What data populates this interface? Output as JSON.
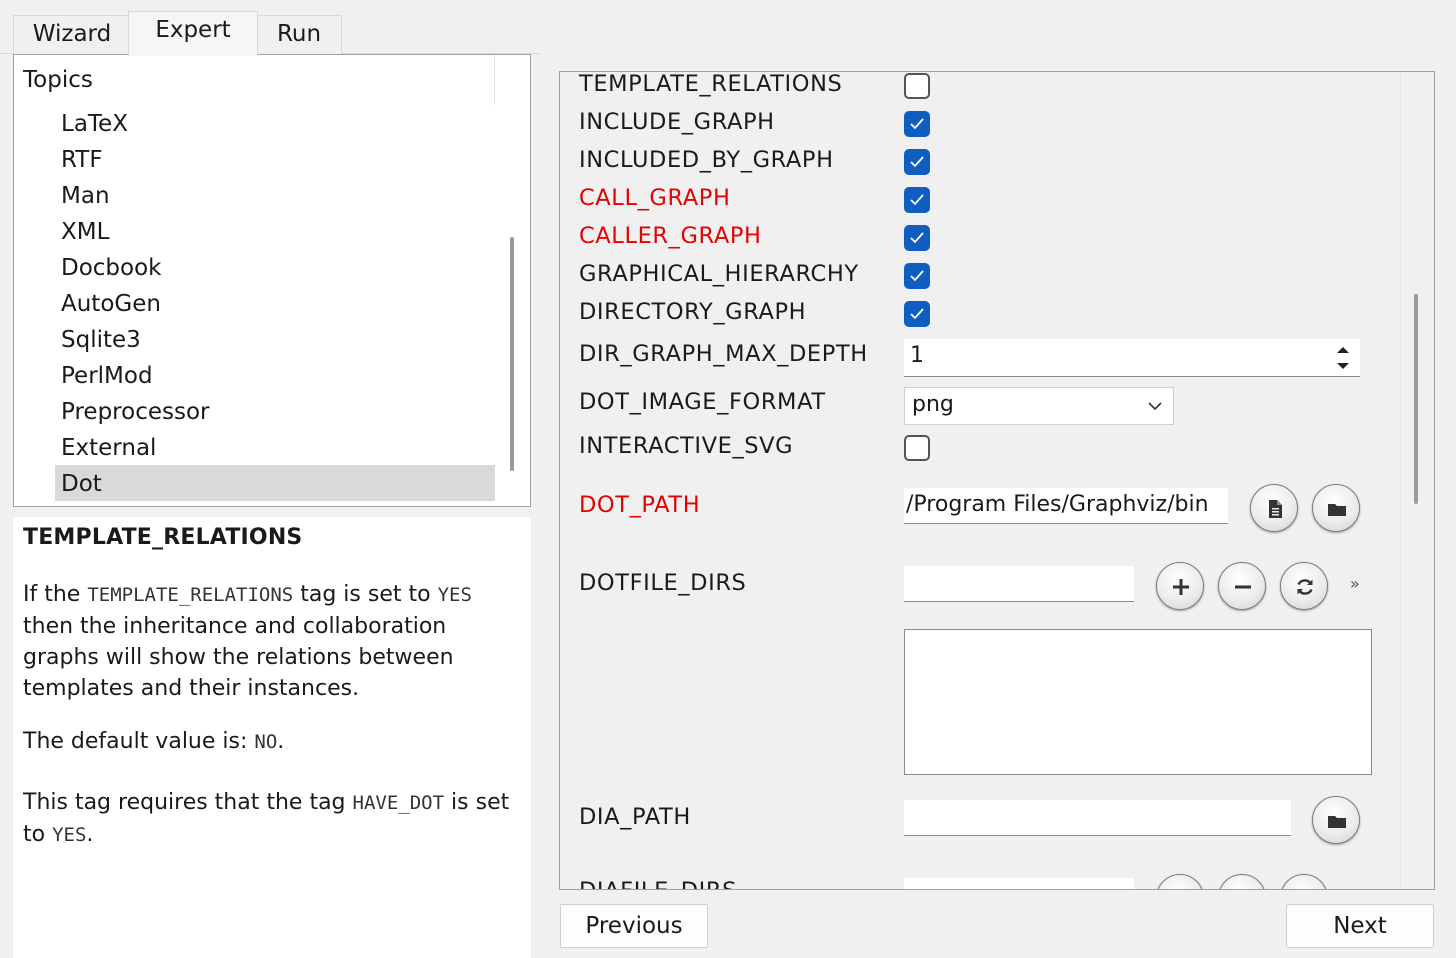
{
  "tabs": [
    {
      "label": "Wizard"
    },
    {
      "label": "Expert"
    },
    {
      "label": "Run"
    }
  ],
  "topics": {
    "header": "Topics",
    "items": [
      "LaTeX",
      "RTF",
      "Man",
      "XML",
      "Docbook",
      "AutoGen",
      "Sqlite3",
      "PerlMod",
      "Preprocessor",
      "External",
      "Dot"
    ],
    "selected": "Dot"
  },
  "help": {
    "title": "TEMPLATE_RELATIONS",
    "p1_a": "If the ",
    "p1_code1": "TEMPLATE_RELATIONS",
    "p1_b": " tag is set to ",
    "p1_code2": "YES",
    "p1_c": " then the inheritance and collaboration graphs will show the relations between templates and their instances.",
    "p2_a": "The default value is: ",
    "p2_code": "NO",
    "p2_b": ".",
    "p3_a": "This tag requires that the tag ",
    "p3_code1": "HAVE_DOT",
    "p3_b": " is set to ",
    "p3_code2": "YES",
    "p3_c": "."
  },
  "settings": {
    "template_relations": {
      "label": "TEMPLATE_RELATIONS",
      "checked": false
    },
    "include_graph": {
      "label": "INCLUDE_GRAPH",
      "checked": true
    },
    "included_by_graph": {
      "label": "INCLUDED_BY_GRAPH",
      "checked": true
    },
    "call_graph": {
      "label": "CALL_GRAPH",
      "checked": true,
      "modified": true
    },
    "caller_graph": {
      "label": "CALLER_GRAPH",
      "checked": true,
      "modified": true
    },
    "graphical_hierarchy": {
      "label": "GRAPHICAL_HIERARCHY",
      "checked": true
    },
    "directory_graph": {
      "label": "DIRECTORY_GRAPH",
      "checked": true
    },
    "dir_graph_max_depth": {
      "label": "DIR_GRAPH_MAX_DEPTH",
      "value": "1"
    },
    "dot_image_format": {
      "label": "DOT_IMAGE_FORMAT",
      "value": "png"
    },
    "interactive_svg": {
      "label": "INTERACTIVE_SVG",
      "checked": false
    },
    "dot_path": {
      "label": "DOT_PATH",
      "value": "/Program Files/Graphviz/bin",
      "modified": true
    },
    "dotfile_dirs": {
      "label": "DOTFILE_DIRS",
      "value": "",
      "more": "»"
    },
    "dia_path": {
      "label": "DIA_PATH",
      "value": ""
    },
    "diafile_dirs": {
      "label": "DIAFILE_DIRS"
    }
  },
  "buttons": {
    "previous": "Previous",
    "next": "Next"
  },
  "colors": {
    "checkbox_accent": "#0f5dc0",
    "modified_label": "#e60000"
  }
}
